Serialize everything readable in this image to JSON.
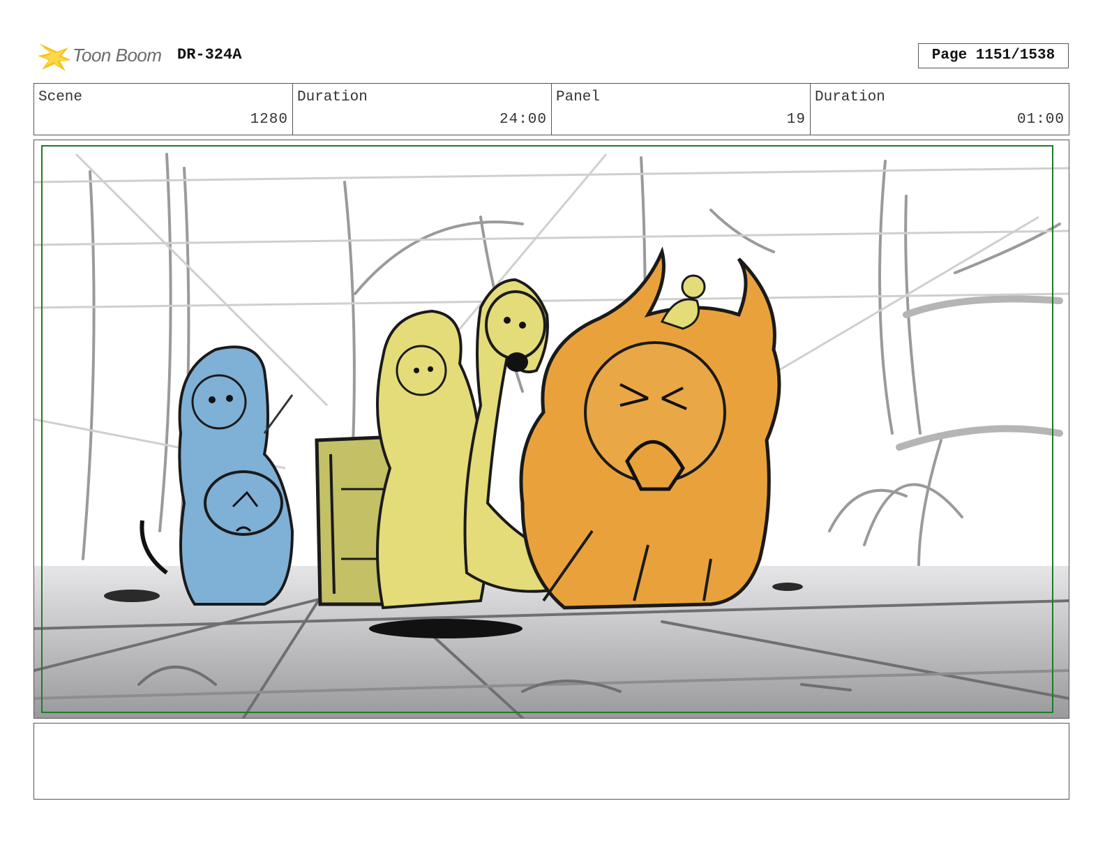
{
  "header": {
    "logo_text": "Toon Boom",
    "production_code": "DR-324A",
    "page_label": "Page 1151/1538"
  },
  "info": {
    "scene_label": "Scene",
    "scene_value": "1280",
    "scene_duration_label": "Duration",
    "scene_duration_value": "24:00",
    "panel_label": "Panel",
    "panel_value": "19",
    "panel_duration_label": "Duration",
    "panel_duration_value": "01:00"
  },
  "colors": {
    "safe_frame": "#1f7a2a",
    "character_blue": "#7fb0d6",
    "character_yellow": "#e3dc78",
    "character_orange": "#e9a23b",
    "logo_yellow": "#f5c518"
  },
  "notes": {
    "text": ""
  }
}
